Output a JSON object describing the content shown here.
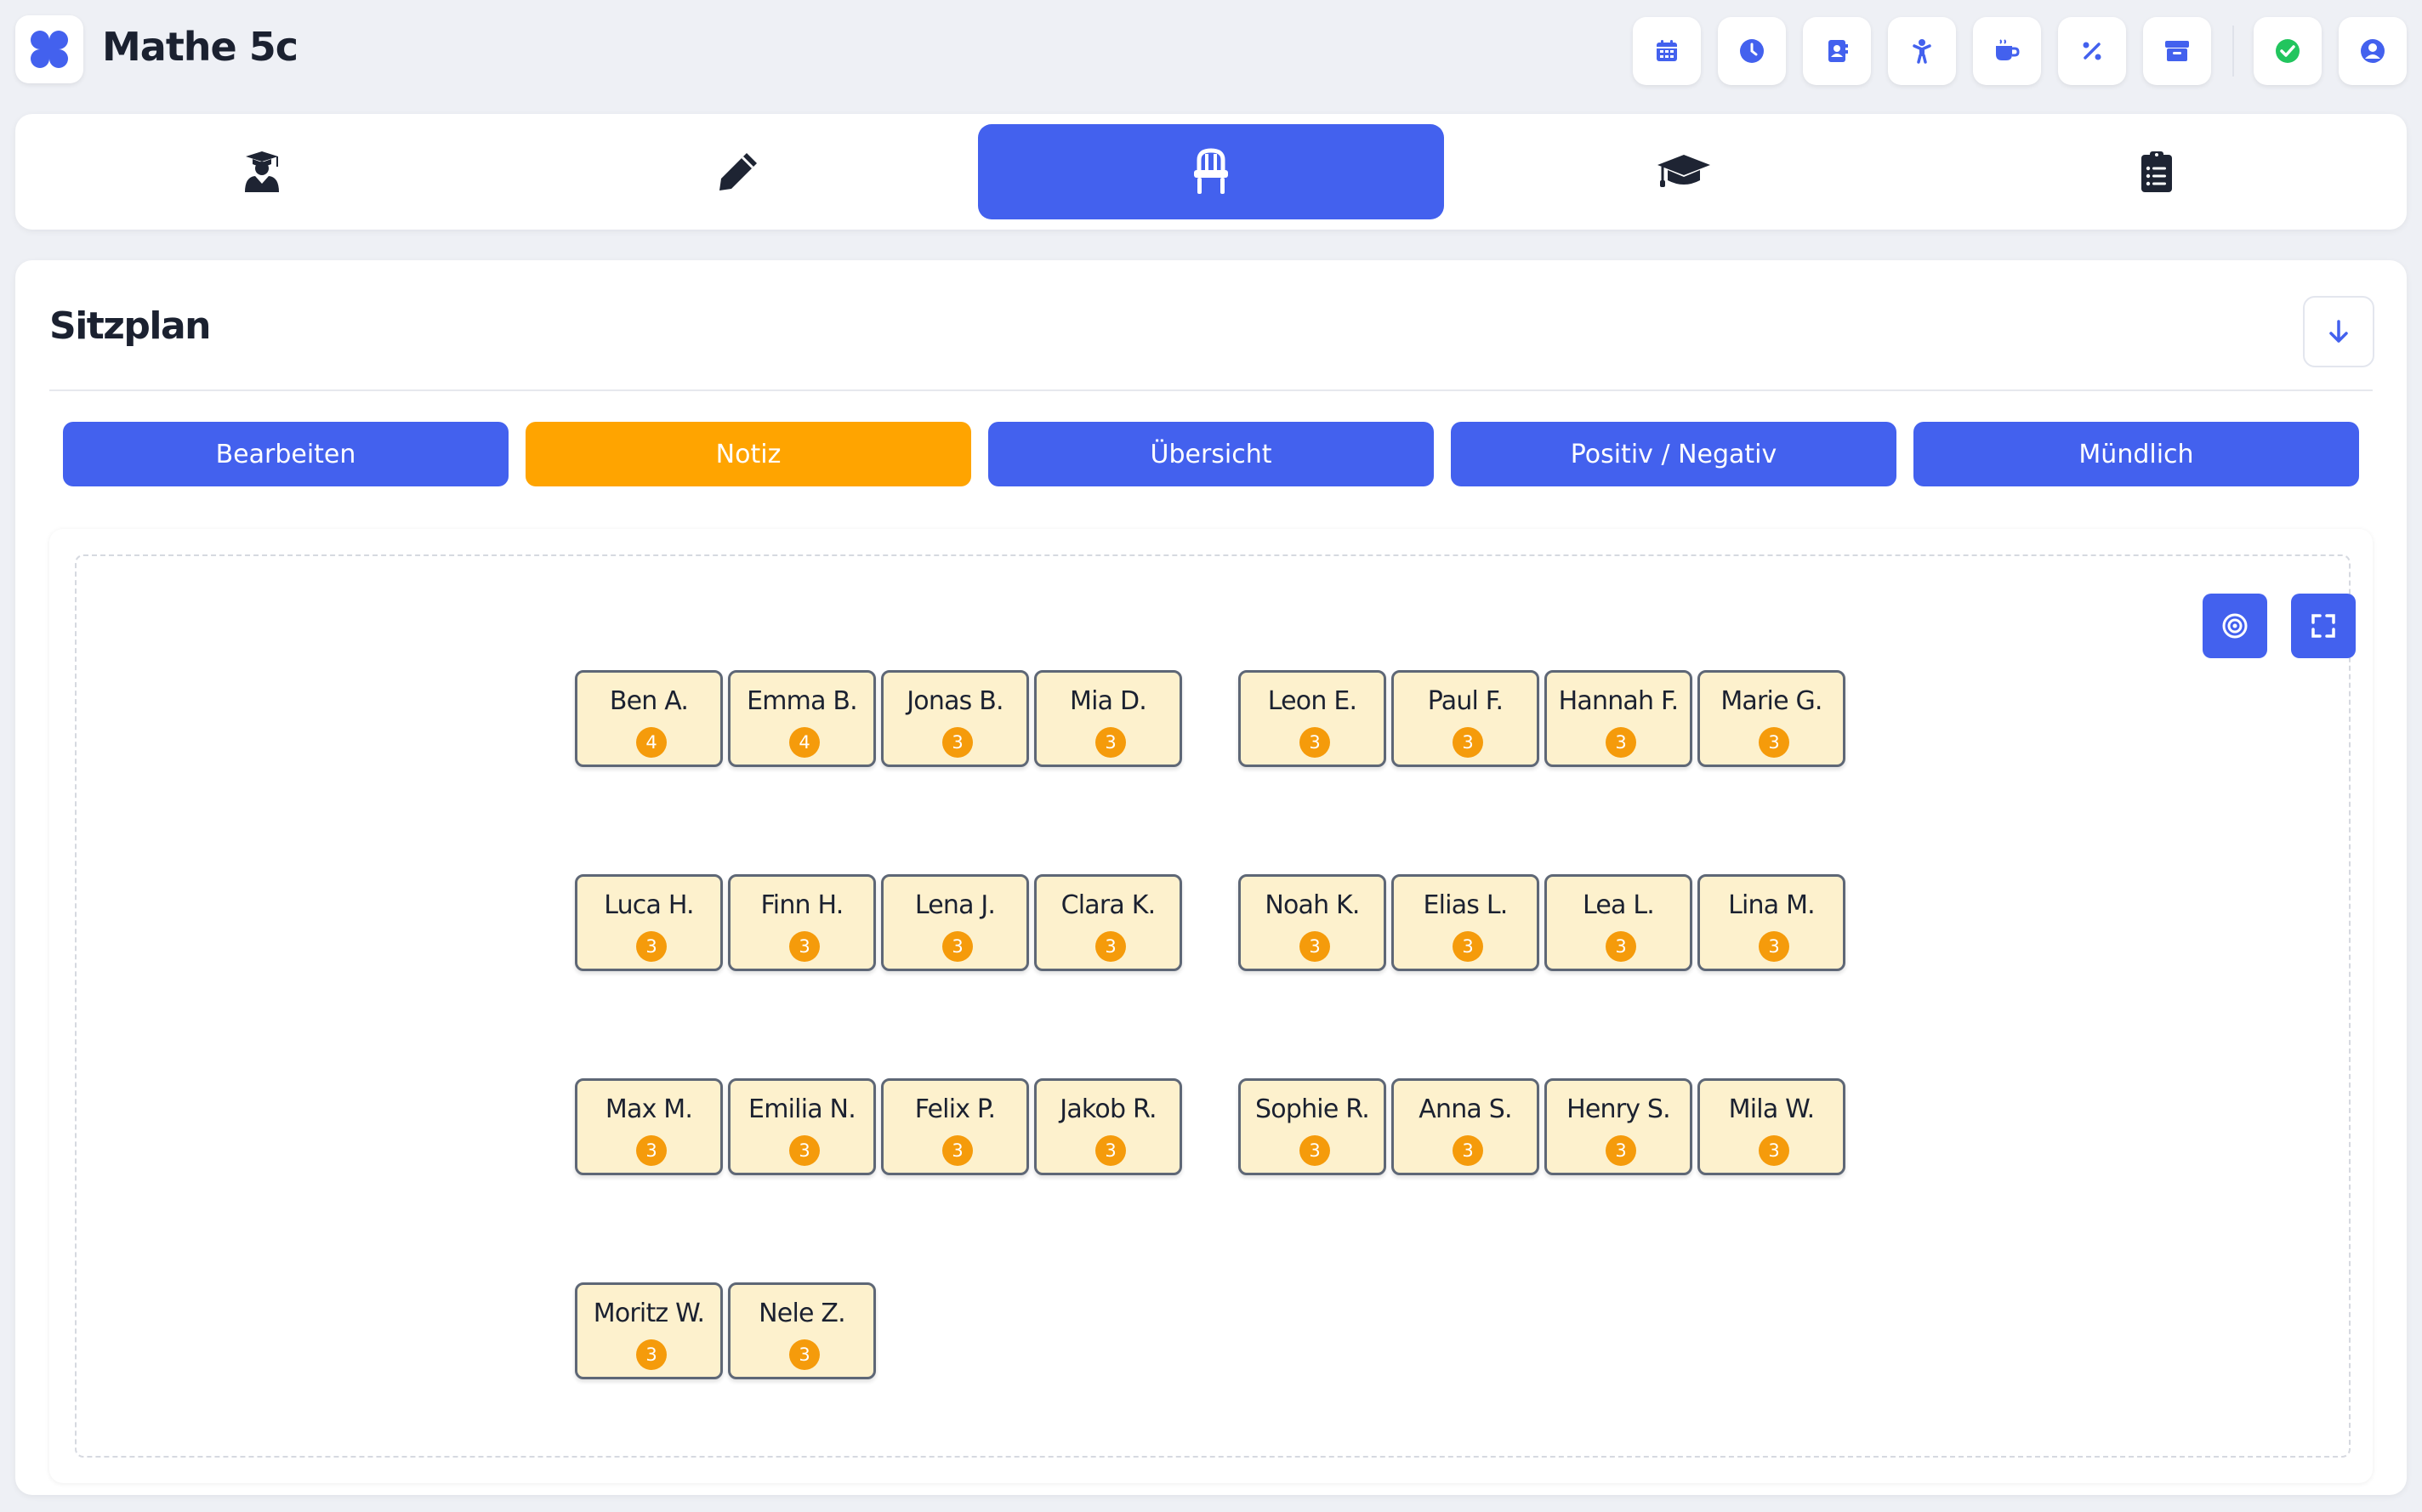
{
  "app": {
    "title": "Mathe 5c",
    "logo_icon": "app-logo-icon"
  },
  "toolbar": {
    "buttons": [
      {
        "icon": "calendar-icon"
      },
      {
        "icon": "clock-icon"
      },
      {
        "icon": "contact-book-icon"
      },
      {
        "icon": "person-icon"
      },
      {
        "icon": "coffee-cup-icon"
      },
      {
        "icon": "percent-icon"
      },
      {
        "icon": "archive-icon"
      },
      {
        "icon": "check-circle-icon",
        "color": "#22c55e"
      },
      {
        "icon": "user-circle-icon"
      }
    ]
  },
  "nav": {
    "tabs": [
      {
        "icon": "teacher-icon",
        "active": false
      },
      {
        "icon": "pencil-icon",
        "active": false
      },
      {
        "icon": "chair-icon",
        "active": true
      },
      {
        "icon": "graduation-cap-icon",
        "active": false
      },
      {
        "icon": "clipboard-list-icon",
        "active": false
      }
    ]
  },
  "section": {
    "title": "Sitzplan",
    "collapse_icon": "arrow-down-icon"
  },
  "modes": [
    {
      "label": "Bearbeiten",
      "active": false
    },
    {
      "label": "Notiz",
      "active": true
    },
    {
      "label": "Übersicht",
      "active": false
    },
    {
      "label": "Positiv / Negativ",
      "active": false
    },
    {
      "label": "Mündlich",
      "active": false
    }
  ],
  "room_buttons": [
    {
      "icon": "target-icon"
    },
    {
      "icon": "fullscreen-icon"
    }
  ],
  "seats": [
    {
      "name": "Ben A.",
      "badge": "4"
    },
    {
      "name": "Emma B.",
      "badge": "4"
    },
    {
      "name": "Jonas B.",
      "badge": "3"
    },
    {
      "name": "Mia D.",
      "badge": "3"
    },
    {
      "name": "Leon E.",
      "badge": "3"
    },
    {
      "name": "Paul F.",
      "badge": "3"
    },
    {
      "name": "Hannah F.",
      "badge": "3"
    },
    {
      "name": "Marie G.",
      "badge": "3"
    },
    {
      "name": "Luca H.",
      "badge": "3"
    },
    {
      "name": "Finn H.",
      "badge": "3"
    },
    {
      "name": "Lena J.",
      "badge": "3"
    },
    {
      "name": "Clara K.",
      "badge": "3"
    },
    {
      "name": "Noah K.",
      "badge": "3"
    },
    {
      "name": "Elias L.",
      "badge": "3"
    },
    {
      "name": "Lea L.",
      "badge": "3"
    },
    {
      "name": "Lina M.",
      "badge": "3"
    },
    {
      "name": "Max M.",
      "badge": "3"
    },
    {
      "name": "Emilia N.",
      "badge": "3"
    },
    {
      "name": "Felix P.",
      "badge": "3"
    },
    {
      "name": "Jakob R.",
      "badge": "3"
    },
    {
      "name": "Sophie R.",
      "badge": "3"
    },
    {
      "name": "Anna S.",
      "badge": "3"
    },
    {
      "name": "Henry S.",
      "badge": "3"
    },
    {
      "name": "Mila W.",
      "badge": "3"
    },
    {
      "name": "Moritz W.",
      "badge": "3"
    },
    {
      "name": "Nele Z.",
      "badge": "3"
    }
  ]
}
